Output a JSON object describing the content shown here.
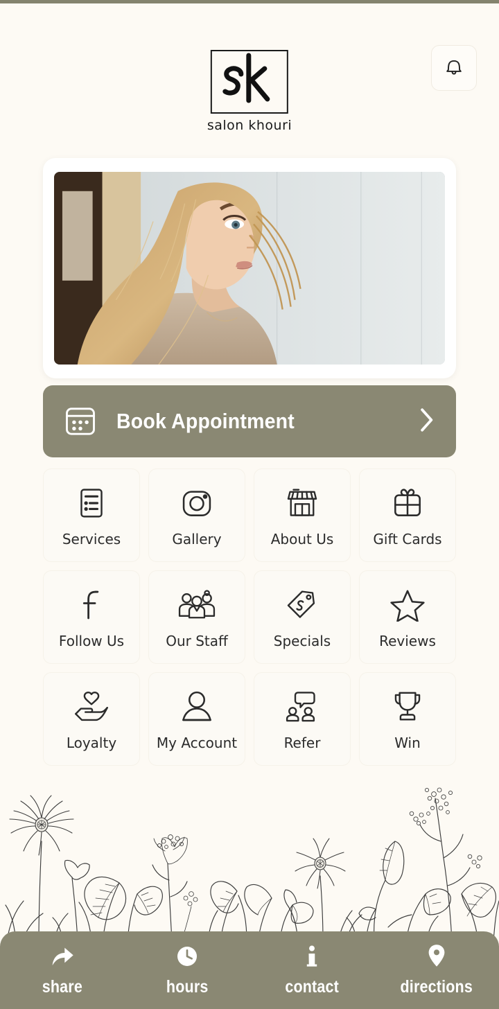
{
  "app": {
    "background_color": "#FDFAF4",
    "accent_color": "#8A8873",
    "card_color": "#FCFAF5",
    "text_color": "#2B2B2B"
  },
  "header": {
    "logo_text": "sk",
    "business_name": "salon khouri",
    "notification_icon": "bell-icon"
  },
  "hero": {
    "alt": "woman-with-blonde-hair-profile-photo"
  },
  "primary_action": {
    "label": "Book Appointment",
    "icon": "calendar-icon",
    "chevron": "chevron-right-icon"
  },
  "grid": {
    "tiles": [
      {
        "label": "Services",
        "icon": "document-list-icon"
      },
      {
        "label": "Gallery",
        "icon": "camera-icon"
      },
      {
        "label": "About Us",
        "icon": "storefront-icon"
      },
      {
        "label": "Gift Cards",
        "icon": "gift-box-icon"
      },
      {
        "label": "Follow Us",
        "icon": "facebook-icon"
      },
      {
        "label": "Our Staff",
        "icon": "people-group-icon"
      },
      {
        "label": "Specials",
        "icon": "price-tag-percent-icon"
      },
      {
        "label": "Reviews",
        "icon": "star-icon"
      },
      {
        "label": "Loyalty",
        "icon": "hand-heart-icon"
      },
      {
        "label": "My Account",
        "icon": "user-icon"
      },
      {
        "label": "Refer",
        "icon": "refer-people-icon"
      },
      {
        "label": "Win",
        "icon": "trophy-icon"
      }
    ]
  },
  "decoration": {
    "name": "botanical-wildflower-illustration"
  },
  "bottom_nav": {
    "items": [
      {
        "label": "share",
        "icon": "share-arrow-icon"
      },
      {
        "label": "hours",
        "icon": "clock-icon"
      },
      {
        "label": "contact",
        "icon": "info-icon"
      },
      {
        "label": "directions",
        "icon": "location-pin-icon"
      }
    ]
  }
}
